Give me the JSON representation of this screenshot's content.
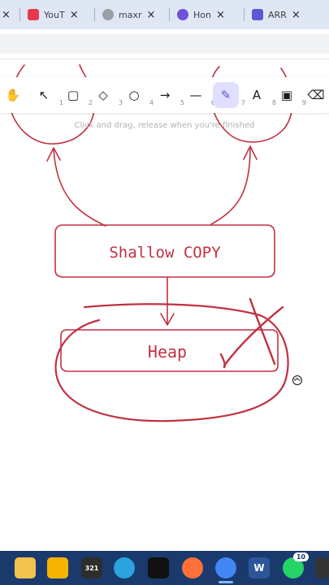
{
  "browser": {
    "tabs": [
      {
        "title": "",
        "close": "×"
      },
      {
        "title": "YouT",
        "close": "×",
        "color": "#e8384f"
      },
      {
        "title": "maxr",
        "close": "×",
        "color": "#9aa0a6"
      },
      {
        "title": "Hon",
        "close": "×",
        "color": "#6e52d9"
      },
      {
        "title": "ARR",
        "close": "×",
        "color": "#5b57d1"
      }
    ]
  },
  "excalidraw": {
    "tools": [
      {
        "icon": "hand-icon",
        "glyph": "✋",
        "key": "1"
      },
      {
        "icon": "pointer-icon",
        "glyph": "↖",
        "key": "1"
      },
      {
        "icon": "rectangle-icon",
        "glyph": "▢",
        "key": "2"
      },
      {
        "icon": "diamond-icon",
        "glyph": "◇",
        "key": "3"
      },
      {
        "icon": "ellipse-icon",
        "glyph": "○",
        "key": "4"
      },
      {
        "icon": "arrow-icon",
        "glyph": "→",
        "key": "5"
      },
      {
        "icon": "line-icon",
        "glyph": "—",
        "key": "6"
      },
      {
        "icon": "pencil-icon",
        "glyph": "✎",
        "key": "7",
        "active": true
      },
      {
        "icon": "text-icon",
        "glyph": "A",
        "key": "8"
      },
      {
        "icon": "image-icon",
        "glyph": "▣",
        "key": "9"
      },
      {
        "icon": "eraser-icon",
        "glyph": "⌫",
        "key": "0"
      }
    ],
    "hint": "Click and drag, release when you're finished",
    "canvas": {
      "box1_label": "Shallow COPY",
      "box2_label": "Heap",
      "stroke_color": "#c03142"
    }
  },
  "taskbar": {
    "apps": [
      {
        "icon": "file-explorer-icon",
        "color": "#f2c14e"
      },
      {
        "icon": "folder-icon",
        "color": "#f5b400"
      },
      {
        "icon": "calendar-icon",
        "label": "321",
        "color": "#2d2d2d"
      },
      {
        "icon": "telegram-icon",
        "color": "#2aa3df"
      },
      {
        "icon": "capcut-icon",
        "color": "#111111"
      },
      {
        "icon": "firefox-icon",
        "color": "#ff7139"
      },
      {
        "icon": "chrome-icon",
        "color": "#4285f4",
        "active": true
      },
      {
        "icon": "word-icon",
        "label": "W",
        "color": "#2b579a"
      },
      {
        "icon": "whatsapp-icon",
        "color": "#25d366",
        "badge": "10"
      },
      {
        "icon": "app-icon",
        "color": "#333333"
      }
    ]
  }
}
